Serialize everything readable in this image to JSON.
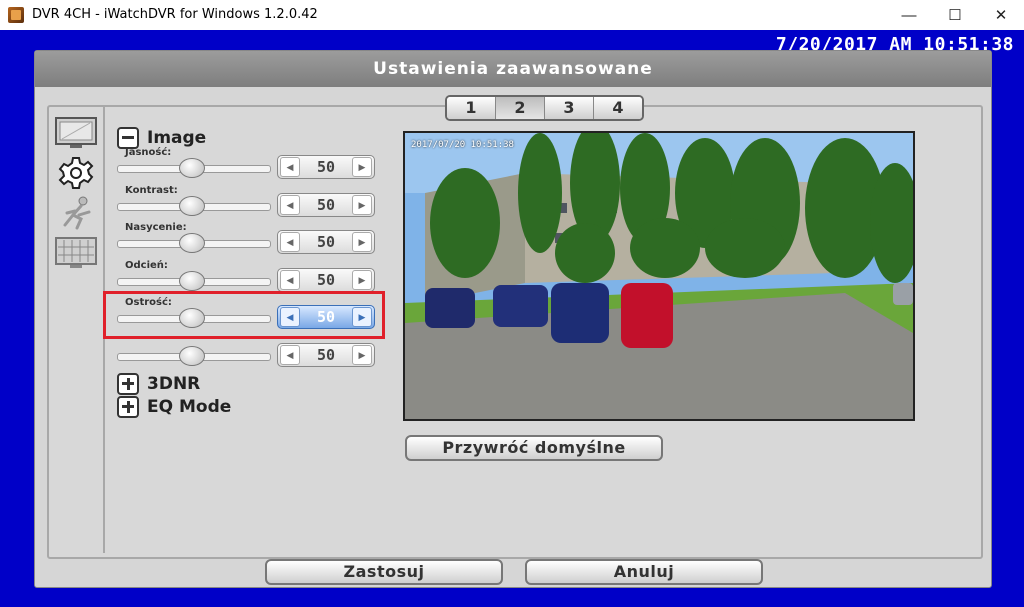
{
  "window": {
    "title": "DVR 4CH - iWatchDVR for Windows 1.2.0.42",
    "minimize": "—",
    "maximize": "☐",
    "close": "✕"
  },
  "clock": "7/20/2017 AM 10:51:38",
  "dialog": {
    "title": "Ustawienia zaawansowane",
    "tabs": [
      "1",
      "2",
      "3",
      "4"
    ],
    "active_tab": "2",
    "sidebar_icons": [
      "monitor-icon",
      "gear-icon",
      "motion-icon",
      "grid-icon"
    ],
    "image_section": "Image",
    "controls": [
      {
        "label": "Jasność:",
        "value": "50"
      },
      {
        "label": "Kontrast:",
        "value": "50"
      },
      {
        "label": "Nasycenie:",
        "value": "50"
      },
      {
        "label": "Odcień:",
        "value": "50"
      },
      {
        "label": "Ostrość:",
        "value": "50"
      },
      {
        "label": "",
        "value": "50"
      }
    ],
    "dnr_section": "3DNR",
    "eq_section": "EQ Mode",
    "preview_timestamp": "2017/07/20 10:51:38",
    "reset_button": "Przywróć domyślne",
    "apply_button": "Zastosuj",
    "cancel_button": "Anuluj"
  },
  "colors": {
    "background": "#0000c8",
    "highlight": "#e0202a",
    "active_stepper": "#7aa8e6"
  }
}
